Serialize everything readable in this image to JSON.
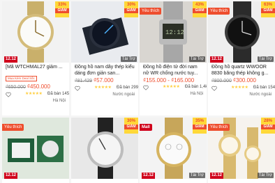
{
  "products_row1": [
    {
      "name": "[Mã WTCHMAL27 giảm ...",
      "badge": "Mall",
      "badge_type": "none",
      "discount": "33%",
      "discount_label": "GIẢM",
      "extra_tag": "Mua Kèm Deal Sốc",
      "price_old": "₫650.000",
      "price_new": "₫450.000",
      "sold": "Đã bán 145",
      "location": "Hà Nội",
      "ad": "Tài Trợ"
    },
    {
      "name": "Đồng hồ nam dây thép kiểu dáng đơn giản san...",
      "badge": "",
      "discount": "30%",
      "discount_label": "GIẢM",
      "price_old": "₫81.429",
      "price_new": "₫57.000",
      "sold": "Đã bán 299",
      "location": "Nước ngoài",
      "ad": "Tài Trợ"
    },
    {
      "name": "Đồng hồ điện tử đời nam nữ WR chống nước tuy...",
      "badge": "Yêu thích",
      "discount": "43%",
      "discount_label": "GIẢM",
      "price_old": "",
      "price_new": "₫155.000 - ₫165.000",
      "sold": "Đã bán 1,4k",
      "location": "Hà Nội",
      "ad": "Tài Trợ"
    },
    {
      "name": "Đồng hồ quartz WWOOR 8830 băng thép không g...",
      "badge": "Yêu thích",
      "discount": "63%",
      "discount_label": "GIẢM",
      "price_old": "₫800.000",
      "price_new": "₫300.000",
      "sold": "Đã bán 154",
      "location": "Nước ngoài",
      "ad": "Tài Trợ"
    }
  ],
  "products_row2": [
    {
      "badge": "Yêu thích",
      "discount": "",
      "ad": ""
    },
    {
      "badge": "",
      "discount": "30%",
      "discount_label": "GIẢM",
      "ad": ""
    },
    {
      "badge": "Mall",
      "discount": "35%",
      "discount_label": "GIẢM",
      "ad": "Tài Trợ"
    },
    {
      "badge": "Yêu thích",
      "discount": "28%",
      "discount_label": "GIẢM",
      "ad": "Tài Trợ"
    }
  ],
  "sale_label": "12.12",
  "stars": "★★★★★",
  "colors": {
    "accent": "#ee4d2d",
    "discount_bg": "#ffd839",
    "star": "#ffce3d"
  }
}
